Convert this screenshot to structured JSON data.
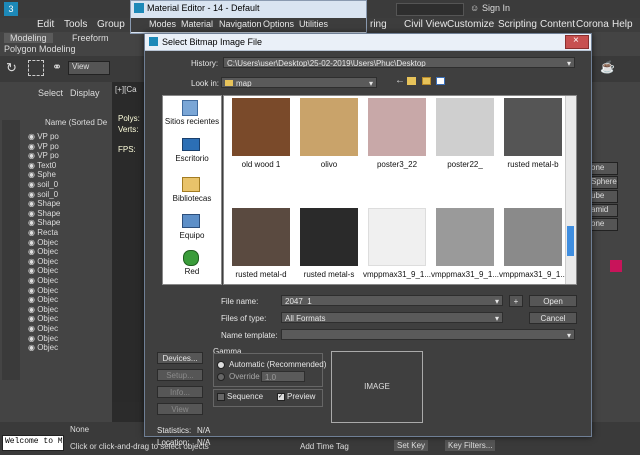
{
  "app": {
    "menu": [
      "Edit",
      "Tools",
      "Group",
      "Vi"
    ],
    "menu_right": [
      "ring",
      "Civil View",
      "Customize",
      "Scripting",
      "Content",
      "Corona",
      "Help"
    ],
    "sign_in": "Sign In",
    "ribbon_tabs": [
      "Modeling",
      "Freeform"
    ],
    "polygon_modeling": "Polygon Modeling",
    "view_label": "View",
    "explorer_tabs": [
      "Select",
      "Display"
    ],
    "explorer_header": "Name (Sorted Desce",
    "explorer_rows": [
      "VP po",
      "VP po",
      "VP po",
      "Text0",
      "Sphe",
      "soil_0",
      "soil_0",
      "Shape",
      "Shape",
      "Shape",
      "Recta",
      "Objec",
      "Objec",
      "Objec",
      "Objec",
      "Objec",
      "Objec",
      "Objec",
      "Objec",
      "Objec",
      "Objec",
      "Objec",
      "Objec"
    ],
    "viewport_label": "[+][Ca",
    "polys": "Polys:",
    "verts": "Verts:",
    "fps": "FPS:",
    "cmd_items": [
      "one",
      "Sphere",
      "ube",
      "amid",
      "one"
    ],
    "status_console": "Welcome to M",
    "status_none": "None",
    "status_hint": "Click or click-and-drag to select objects",
    "add_time_tag": "Add Time Tag",
    "set_key": "Set Key",
    "key_filters": "Key Filters..."
  },
  "material_editor": {
    "title": "Material Editor - 14 - Default",
    "menu": [
      "Modes",
      "Material",
      "Navigation",
      "Options",
      "Utilities"
    ]
  },
  "dialog": {
    "title": "Select Bitmap Image File",
    "history_label": "History:",
    "history_value": "C:\\Users\\user\\Desktop\\25-02-2019\\Users\\Phuc\\Desktop",
    "lookin_label": "Look in:",
    "lookin_value": "map",
    "places": [
      "Sitios recientes",
      "Escritorio",
      "Bibliotecas",
      "Equipo",
      "Red"
    ],
    "files": [
      {
        "name": "old wood 1",
        "color": "#7a4a2a"
      },
      {
        "name": "olivo",
        "color": "#c9a36a"
      },
      {
        "name": "poster3_22",
        "color": "#c8a8a8"
      },
      {
        "name": "poster22_",
        "color": "#cfcfcf"
      },
      {
        "name": "rusted metal-b",
        "color": "#555555"
      },
      {
        "name": "rusted metal-d",
        "color": "#5a4a40"
      },
      {
        "name": "rusted metal-s",
        "color": "#2a2a2a"
      },
      {
        "name": "vmppmax31_9_1...",
        "color": "#f0f0f0"
      },
      {
        "name": "vmppmax31_9_1...",
        "color": "#9a9a9a"
      },
      {
        "name": "vmppmax31_9_1...",
        "color": "#8a8a8a"
      }
    ],
    "filename_label": "File name:",
    "filename_value": "2047_1",
    "filetype_label": "Files of type:",
    "filetype_value": "All Formats",
    "template_label": "Name template:",
    "open_btn": "Open",
    "cancel_btn": "Cancel",
    "devices_btn": "Devices...",
    "setup_btn": "Setup...",
    "info_btn": "Info...",
    "view_btn": "View",
    "gamma_label": "Gamma",
    "gamma_auto": "Automatic (Recommended)",
    "gamma_override": "Override",
    "gamma_value": "1.0",
    "sequence_label": "Sequence",
    "preview_label": "Preview",
    "image_label": "IMAGE",
    "statistics_label": "Statistics:",
    "statistics_value": "N/A",
    "location_label": "Location:",
    "location_value": "N/A"
  }
}
